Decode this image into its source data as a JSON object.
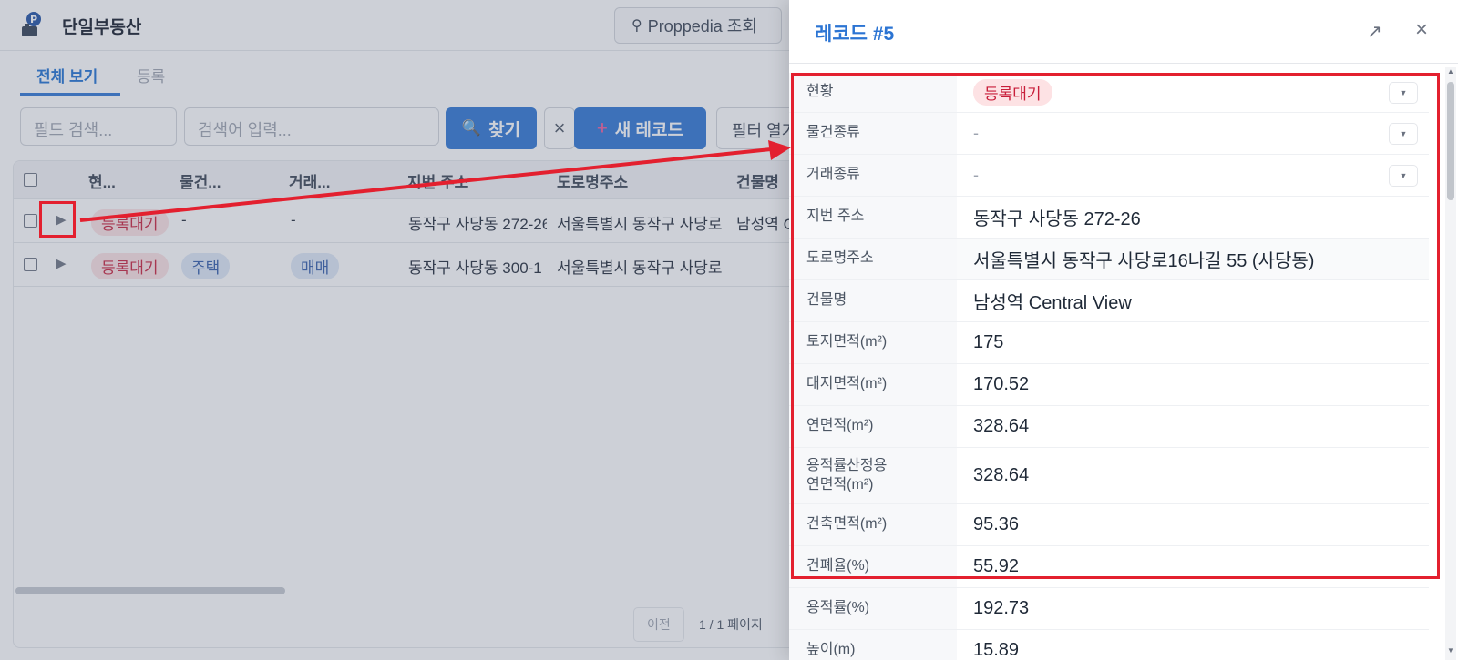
{
  "app": {
    "title": "단일부동산",
    "proppedia_button": "Proppedia 조회"
  },
  "tabs": [
    {
      "label": "전체 보기",
      "active": true
    },
    {
      "label": "등록",
      "active": false
    }
  ],
  "toolbar": {
    "field_search_placeholder": "필드 검색...",
    "keyword_placeholder": "검색어 입력...",
    "find_label": "찾기",
    "new_record_label": "새 레코드",
    "filter_label": "필터 열기"
  },
  "table": {
    "headers": [
      "현...",
      "물건...",
      "거래...",
      "지번 주소",
      "도로명주소",
      "건물명"
    ],
    "rows": [
      {
        "status": "등록대기",
        "type": "-",
        "deal": "-",
        "jibun": "동작구 사당동 272-26",
        "road": "서울특별시 동작구 사당로",
        "building": "남성역 Central View"
      },
      {
        "status": "등록대기",
        "type": "주택",
        "deal": "매매",
        "jibun": "동작구 사당동 300-1",
        "road": "서울특별시 동작구 사당로",
        "building": ""
      }
    ],
    "pager": {
      "prev": "이전",
      "page_info": "1 / 1 페이지"
    }
  },
  "drawer": {
    "title": "레코드 #5",
    "fields": [
      {
        "label": "현황",
        "value": "등록대기"
      },
      {
        "label": "물건종류",
        "value": "-"
      },
      {
        "label": "거래종류",
        "value": "-"
      },
      {
        "label": "지번 주소",
        "value": "동작구 사당동 272-26"
      },
      {
        "label": "도로명주소",
        "value": "서울특별시 동작구 사당로16나길 55 (사당동)"
      },
      {
        "label": "건물명",
        "value": "남성역 Central View"
      },
      {
        "label": "토지면적(m²)",
        "value": "175"
      },
      {
        "label": "대지면적(m²)",
        "value": "170.52"
      },
      {
        "label": "연면적(m²)",
        "value": "328.64"
      },
      {
        "label": "용적률산정용",
        "label2": "연면적(m²)",
        "value": "328.64"
      },
      {
        "label": "건축면적(m²)",
        "value": "95.36"
      },
      {
        "label": "건폐율(%)",
        "value": "55.92"
      },
      {
        "label": "용적률(%)",
        "value": "192.73"
      },
      {
        "label": "높이(m)",
        "value": "15.89"
      }
    ]
  },
  "colors": {
    "accent": "#2b74d3",
    "annotation": "#e3202f",
    "status_pill_bg": "#fde2e4",
    "status_pill_text": "#c81e3a"
  }
}
